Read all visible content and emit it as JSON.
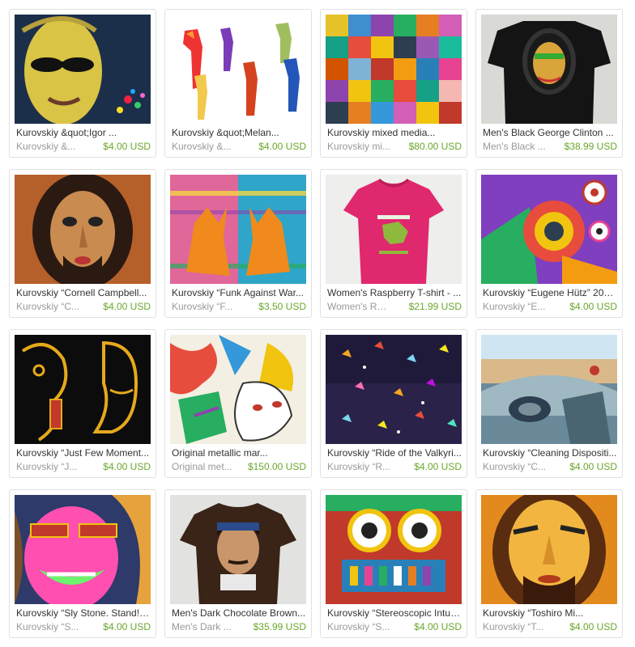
{
  "products": [
    {
      "title": "Kurovskiy &quot;Igor ...",
      "seller": "Kurovskiy &...",
      "price": "$4.00 USD"
    },
    {
      "title": "Kurovskiy &quot;Melan...",
      "seller": "Kurovskiy &...",
      "price": "$4.00 USD"
    },
    {
      "title": "Kurovskiy mixed media...",
      "seller": "Kurovskiy mi...",
      "price": "$80.00 USD"
    },
    {
      "title": "Men's Black George Clinton ...",
      "seller": "Men's Black ...",
      "price": "$38.99 USD"
    },
    {
      "title": "Kurovskiy “Cornell Campbell...",
      "seller": "Kurovskiy “C...",
      "price": "$4.00 USD"
    },
    {
      "title": "Kurovskiy “Funk Against War...",
      "seller": "Kurovskiy “F...",
      "price": "$3.50 USD"
    },
    {
      "title": "Women's Raspberry T-shirt - ...",
      "seller": "Women's Ra...",
      "price": "$21.99 USD"
    },
    {
      "title": "Kurovskiy “Eugene Hütz” 200...",
      "seller": "Kurovskiy “E...",
      "price": "$4.00 USD"
    },
    {
      "title": "Kurovskiy “Just Few Moment...",
      "seller": "Kurovskiy “J...",
      "price": "$4.00 USD"
    },
    {
      "title": "Original metallic mar...",
      "seller": "Original met...",
      "price": "$150.00 USD"
    },
    {
      "title": "Kurovskiy “Ride of the Valkyri...",
      "seller": "Kurovskiy “R...",
      "price": "$4.00 USD"
    },
    {
      "title": "Kurovskiy “Cleaning Dispositi...",
      "seller": "Kurovskiy “C...",
      "price": "$4.00 USD"
    },
    {
      "title": "Kurovskiy “Sly Stone. Stand!”...",
      "seller": "Kurovskiy “S...",
      "price": "$4.00 USD"
    },
    {
      "title": "Men's Dark Chocolate Brown...",
      "seller": "Men's Dark ...",
      "price": "$35.99 USD"
    },
    {
      "title": "Kurovskiy “Stereoscopic Intuit...",
      "seller": "Kurovskiy “S...",
      "price": "$4.00 USD"
    },
    {
      "title": "Kurovskiy “Toshiro Mi...",
      "seller": "Kurovskiy “T...",
      "price": "$4.00 USD"
    }
  ],
  "colors": {
    "price": "#6aa62a",
    "title": "#333333",
    "seller": "#999999",
    "card_border": "#e1e1e1"
  }
}
